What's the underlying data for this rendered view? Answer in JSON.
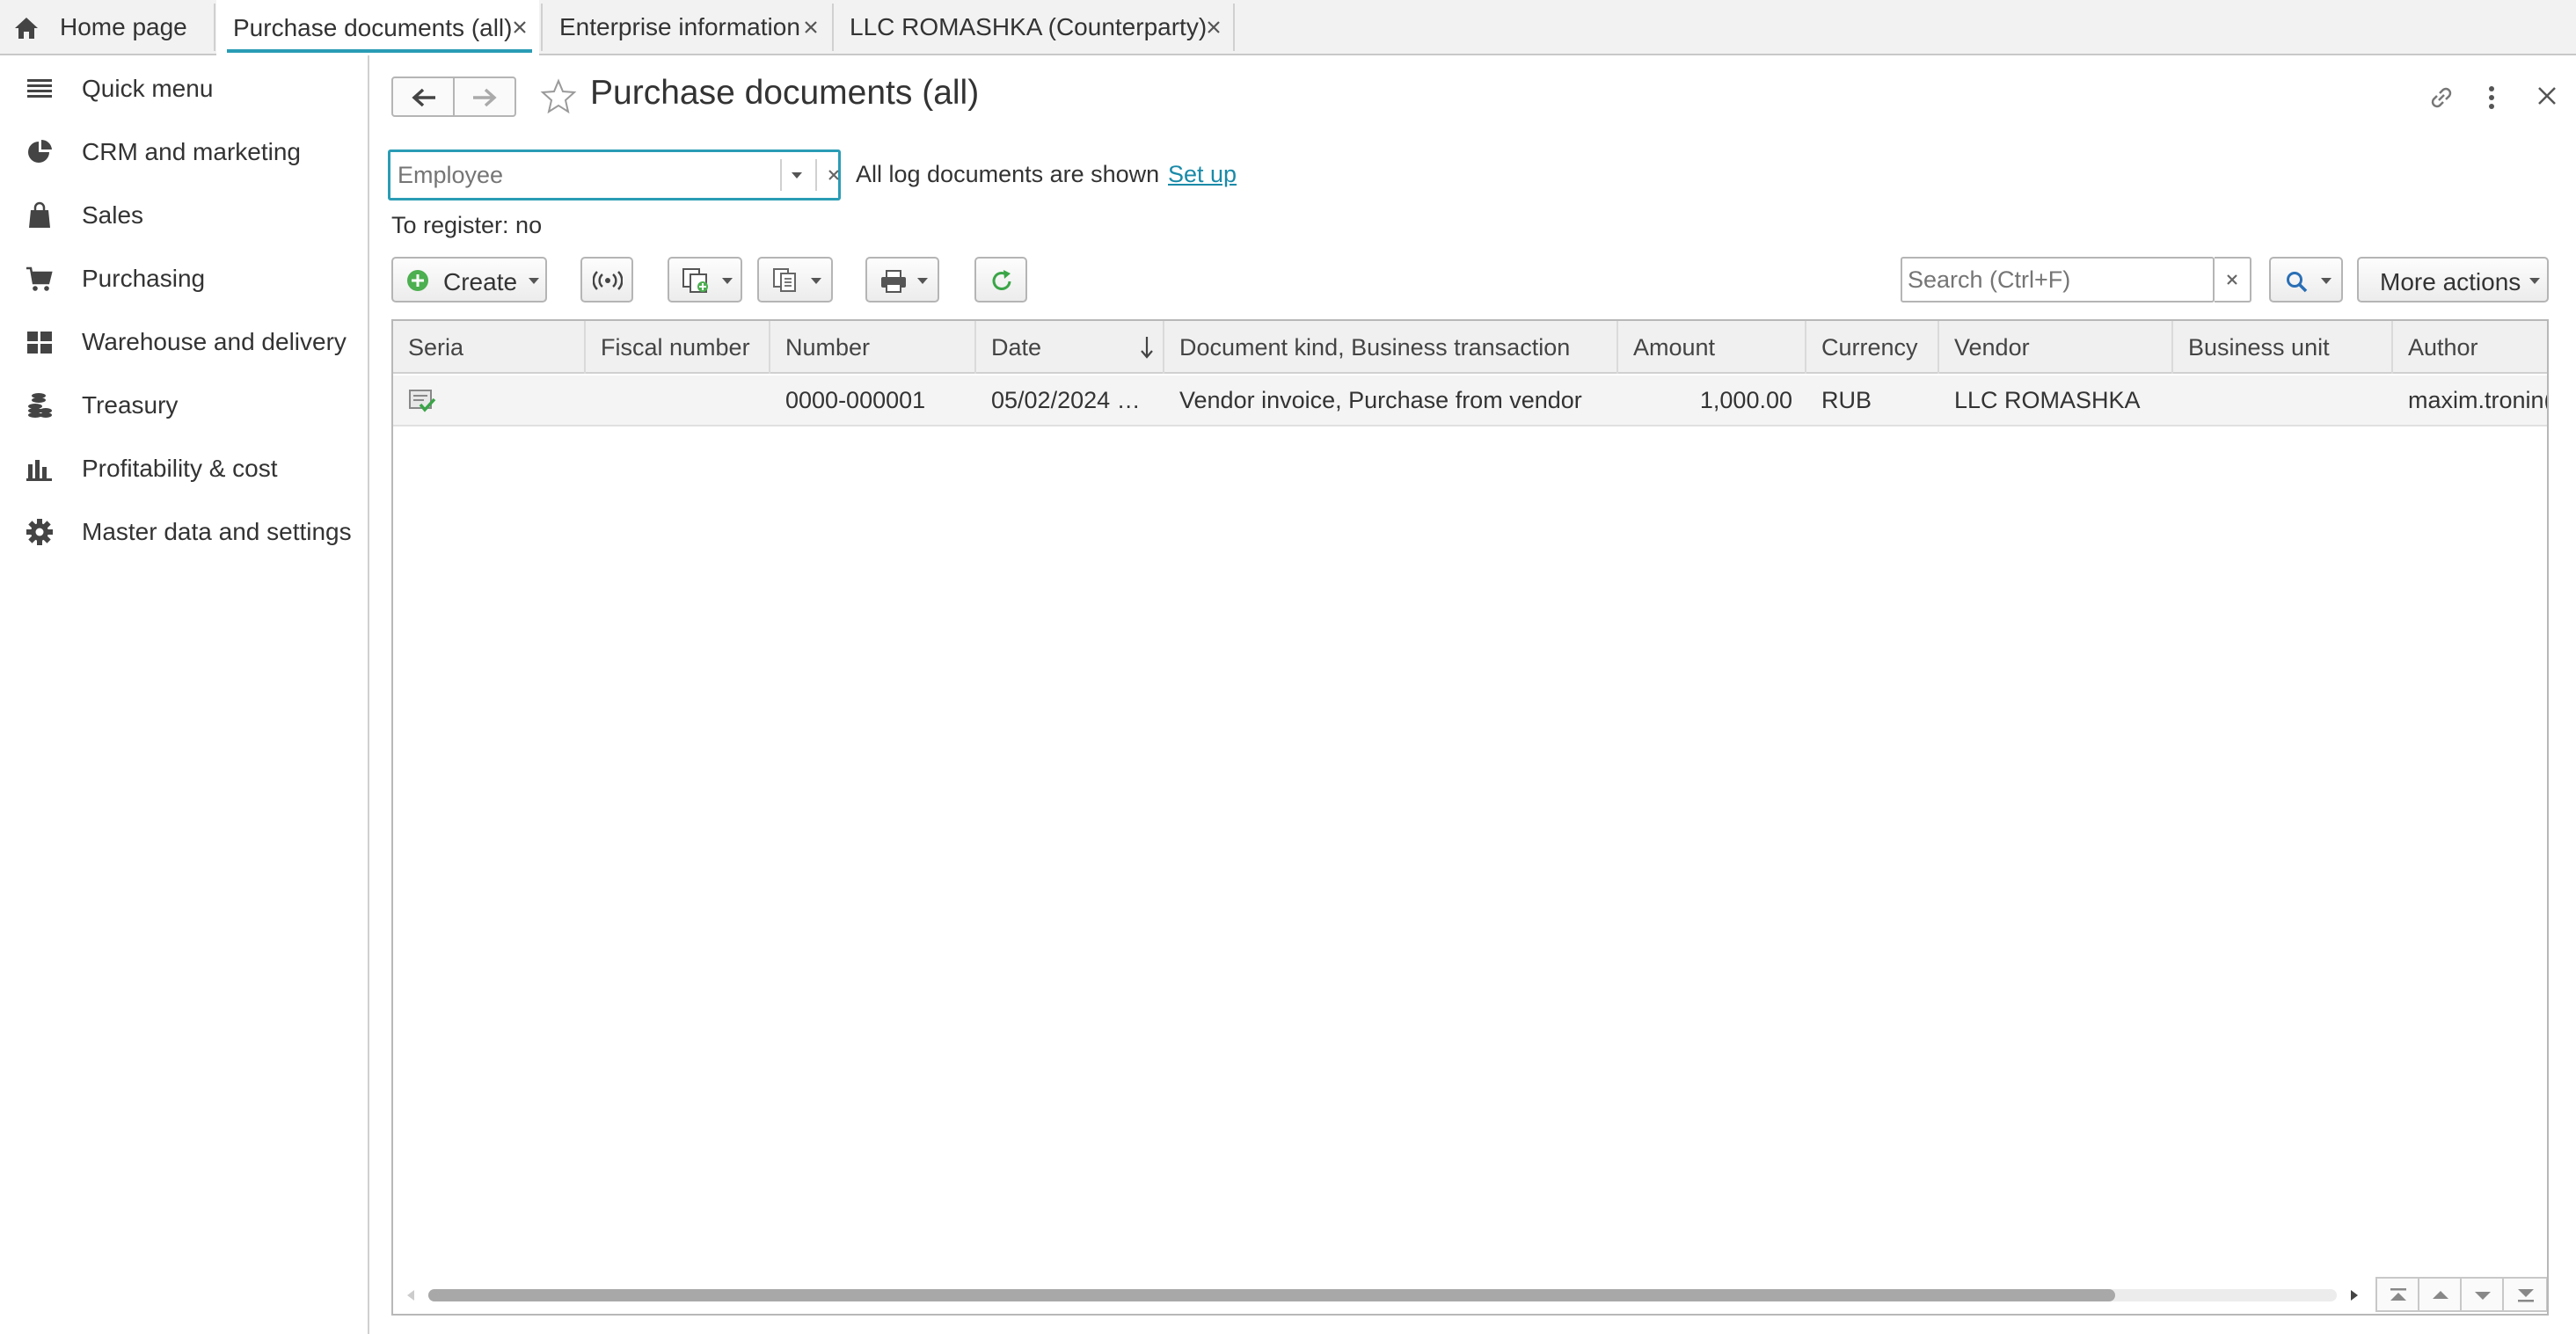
{
  "tabs": [
    {
      "label": "Home page"
    },
    {
      "label": "Purchase documents (all)"
    },
    {
      "label": "Enterprise information"
    },
    {
      "label": "LLC ROMASHKA (Counterparty)"
    }
  ],
  "sidebar": {
    "items": [
      {
        "label": "Quick menu",
        "icon": "menu-icon"
      },
      {
        "label": "CRM and marketing",
        "icon": "pie-chart-icon"
      },
      {
        "label": "Sales",
        "icon": "shopping-bag-icon"
      },
      {
        "label": "Purchasing",
        "icon": "cart-icon"
      },
      {
        "label": "Warehouse and delivery",
        "icon": "grid-icon"
      },
      {
        "label": "Treasury",
        "icon": "coins-icon"
      },
      {
        "label": "Profitability & cost",
        "icon": "bar-chart-icon"
      },
      {
        "label": "Master data and settings",
        "icon": "gear-icon"
      }
    ]
  },
  "page": {
    "title": "Purchase documents (all)",
    "employee_placeholder": "Employee",
    "filter_status": "All log documents are shown",
    "setup_link": "Set up",
    "to_register": "To register: no"
  },
  "toolbar": {
    "create_label": "Create",
    "search_placeholder": "Search (Ctrl+F)",
    "more_actions_label": "More actions"
  },
  "table": {
    "columns": [
      "Seria",
      "Fiscal number",
      "Number",
      "Date",
      "Document kind, Business transaction",
      "Amount",
      "Currency",
      "Vendor",
      "Business unit",
      "Author"
    ],
    "rows": [
      {
        "seria": "",
        "fiscal_number": "",
        "number": "0000-000001",
        "date": "05/02/2024 …",
        "kind": "Vendor invoice, Purchase from vendor",
        "amount": "1,000.00",
        "currency": "RUB",
        "vendor": "LLC ROMASHKA",
        "business_unit": "",
        "author": "maxim.tronin("
      }
    ]
  },
  "colors": {
    "accent": "#2a9cb5",
    "link": "#1a8aa8",
    "create_green": "#4caf50"
  }
}
